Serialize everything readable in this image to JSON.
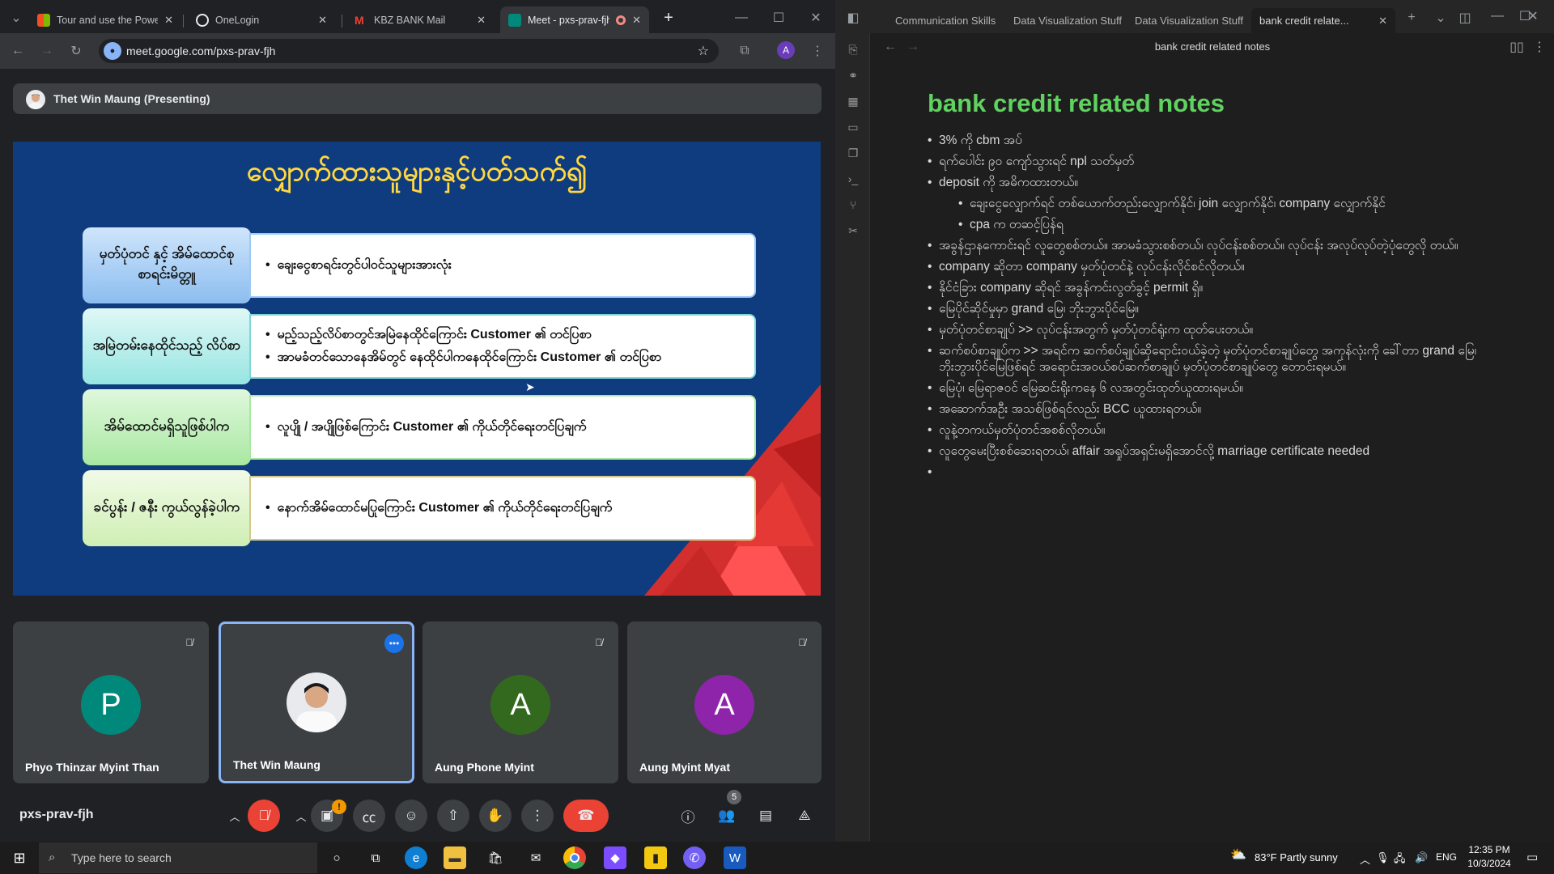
{
  "chrome": {
    "tabs": [
      {
        "title": "Tour and use the Power BI",
        "color": "#f25022"
      },
      {
        "title": "OneLogin",
        "color": "#1c1c1c"
      },
      {
        "title": "KBZ BANK Mail",
        "color": "#ea4335"
      },
      {
        "title": "Meet - pxs-prav-fjh",
        "color": "#00897b"
      }
    ],
    "new_tab": "+",
    "url": "meet.google.com/pxs-prav-fjh",
    "profile_initial": "A"
  },
  "meet": {
    "presenting_label": "Thet Win Maung (Presenting)",
    "slide": {
      "title": "လျှောက်ထားသူများနှင့်ပတ်သက်၍",
      "rows": [
        {
          "label": "မှတ်ပုံတင် နှင့် အိမ်ထောင်စုစာရင်းမိတ္တူ",
          "items": [
            "ချေးငွေစာရင်းတွင်ပါဝင်သူများအားလုံး"
          ],
          "color": "#9ec9f5"
        },
        {
          "label": "အမြဲတမ်းနေထိုင်သည့် လိပ်စာ",
          "items": [
            "မည့်သည့်လိပ်စာတွင်အမြဲနေထိုင်ကြောင်း Customer ၏ တင်ပြစာ",
            "အာမခံတင်သောနေအိမ်တွင် နေထိုင်ပါကနေထိုင်ကြောင်း Customer ၏ တင်ပြစာ"
          ],
          "color": "#a6ecea"
        },
        {
          "label": "အိမ်ထောင်မရှိသူဖြစ်ပါက",
          "items": [
            "လူပျို / အပျိုဖြစ်ကြောင်း Customer ၏ ကိုယ်တိုင်ရေးတင်ပြချက်"
          ],
          "color": "#b9f0b4"
        },
        {
          "label": "ခင်ပွန်း / ဇနီး ကွယ်လွန်ခဲ့ပါက",
          "items": [
            "နောက်အိမ်ထောင်မပြုကြောင်း Customer ၏ ကိုယ်တိုင်ရေးတင်ပြချက်"
          ],
          "color": "#dff3c8"
        }
      ]
    },
    "participants": [
      {
        "name": "Phyo Thinzar Myint Than",
        "initial": "P",
        "color": "#00897b"
      },
      {
        "name": "Thet Win Maung",
        "initial": "",
        "color": "#e8eaed"
      },
      {
        "name": "Aung Phone Myint",
        "initial": "A",
        "color": "#33691e"
      },
      {
        "name": "Aung Myint Myat",
        "initial": "A",
        "color": "#8e24aa"
      }
    ],
    "meeting_code": "pxs-prav-fjh",
    "people_count": "5",
    "camera_alert": "!"
  },
  "obsidian": {
    "tabs": [
      "Communication Skills",
      "Data Visualization Stuff",
      "Data Visualization Stuff",
      "bank credit relate..."
    ],
    "header": "bank credit related notes",
    "title": "bank credit related notes",
    "notes": [
      "3% ကို cbm အပ်",
      "ရက်ပေါင်း ၉၀ ကျော်သွားရင် npl သတ်မှတ်",
      " deposit ကို အဓိကထားတယ်။",
      "ချေးငွေလျှောက်ရင် တစ်ယောက်တည်းလျှောက်နိုင်၊ join လျှောက်နိုင်၊ company လျှောက်နိုင်",
      "cpa က တဆင့်ပြန်ရ",
      "အခွန်ဌာနကောင်းရင် လူတွေစစ်တယ်။ အာမခံသွားစစ်တယ်၊ လုပ်ငန်းစစ်တယ်။ လုပ်ငန်း အလုပ်လုပ်တဲ့ပုံတွေလို တယ်။",
      "company ဆိုတာ company မှတ်ပုံတင်နဲ့ လုပ်ငန်းလိုင်စင်လိုတယ်။",
      "နိုင်ငံခြား company ဆိုရင် အခွန်ကင်းလွတ်ခွင့် permit ရှိ။",
      "မြေပိုင်ဆိုင်မှုမှာ grand မြေ၊ ဘိုးဘွားပိုင်မြေ။",
      "မှတ်ပုံတင်စာချုပ် >> လုပ်ငန်းအတွက် မှတ်ပုံတင်ရုံးက ထုတ်ပေးတယ်။",
      "ဆက်စပ်စာချုပ်က >> အရင်က ဆက်စပ်ချုပ်ဆိုရောင်းဝယ်ခဲ့တဲ့ မှတ်ပုံတင်စာချုပ်တွေ အကုန်လုံးကို ခေါ်တာ grand မြေ၊ ဘိုးဘွားပိုင်မြေဖြစ်ရင် အရောင်းအဝယ်စပ်ဆက်စာချုပ် မှတ်ပုံတင်စာချုပ်တွေ တောင်းရမယ်။",
      "မြေပုံ၊ မြေရာဇဝင် မြေဆင်းရိုးကနေ ၆ လအတွင်းထုတ်ယူထားရမယ်။",
      "အဆောက်အဦး အသစ်ဖြစ်ရင်လည်း BCC ယူထားရတယ်။",
      "လူနဲ့တကယ်မှတ်ပုံတင်အစစ်လိုတယ်။",
      "လူတွေမေးပြီးစစ်ဆေးရတယ်၊ affair အရှုပ်အရှင်းမရှိအောင်လို့ marriage certificate needed",
      ""
    ]
  },
  "taskbar": {
    "search_placeholder": "Type here to search",
    "weather": "83°F  Partly sunny",
    "lang": "ENG",
    "time": "12:35 PM",
    "date": "10/3/2024"
  }
}
